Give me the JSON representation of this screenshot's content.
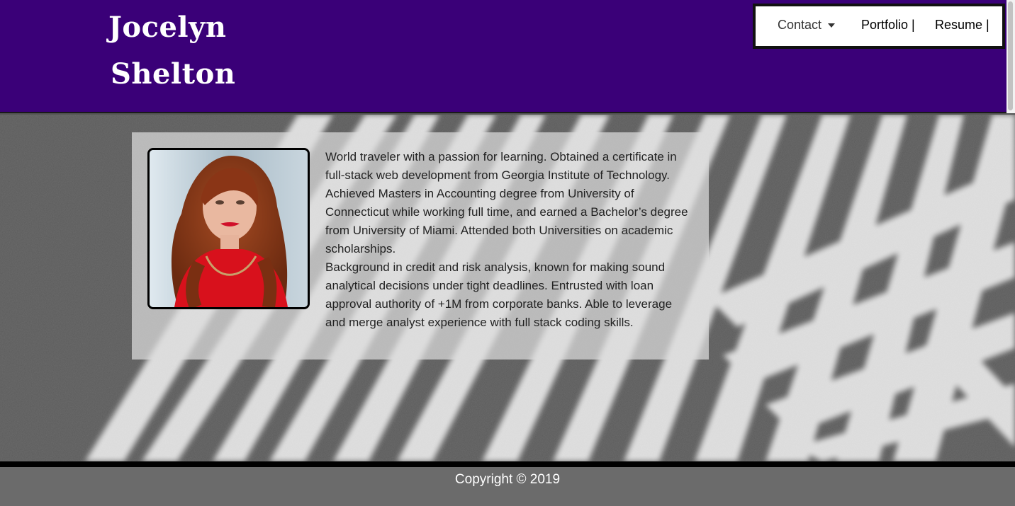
{
  "header": {
    "name_line1": "Jocelyn",
    "name_line2": "Shelton"
  },
  "nav": {
    "contact_label": "Contact",
    "portfolio_label": "Portfolio |",
    "resume_label": "Resume |"
  },
  "about": {
    "paragraph1": "World traveler with a passion for learning. Obtained a certificate in full-stack web development from Georgia Institute of Technology. Achieved Masters in Accounting degree from University of Connecticut while working full time, and earned a Bachelor’s degree from University of Miami. Attended both Universities on academic scholarships.",
    "paragraph2": "Background in credit and risk analysis, known for making sound analytical decisions under tight deadlines. Entrusted with loan approval authority of +1M from corporate banks. Able to leverage and merge analyst experience with full stack coding skills."
  },
  "footer": {
    "copyright": "Copyright © 2019"
  },
  "colors": {
    "header_bg": "#3a0078",
    "footer_bg": "#6b6b6b",
    "hero_bg": "#5a5a5a"
  }
}
